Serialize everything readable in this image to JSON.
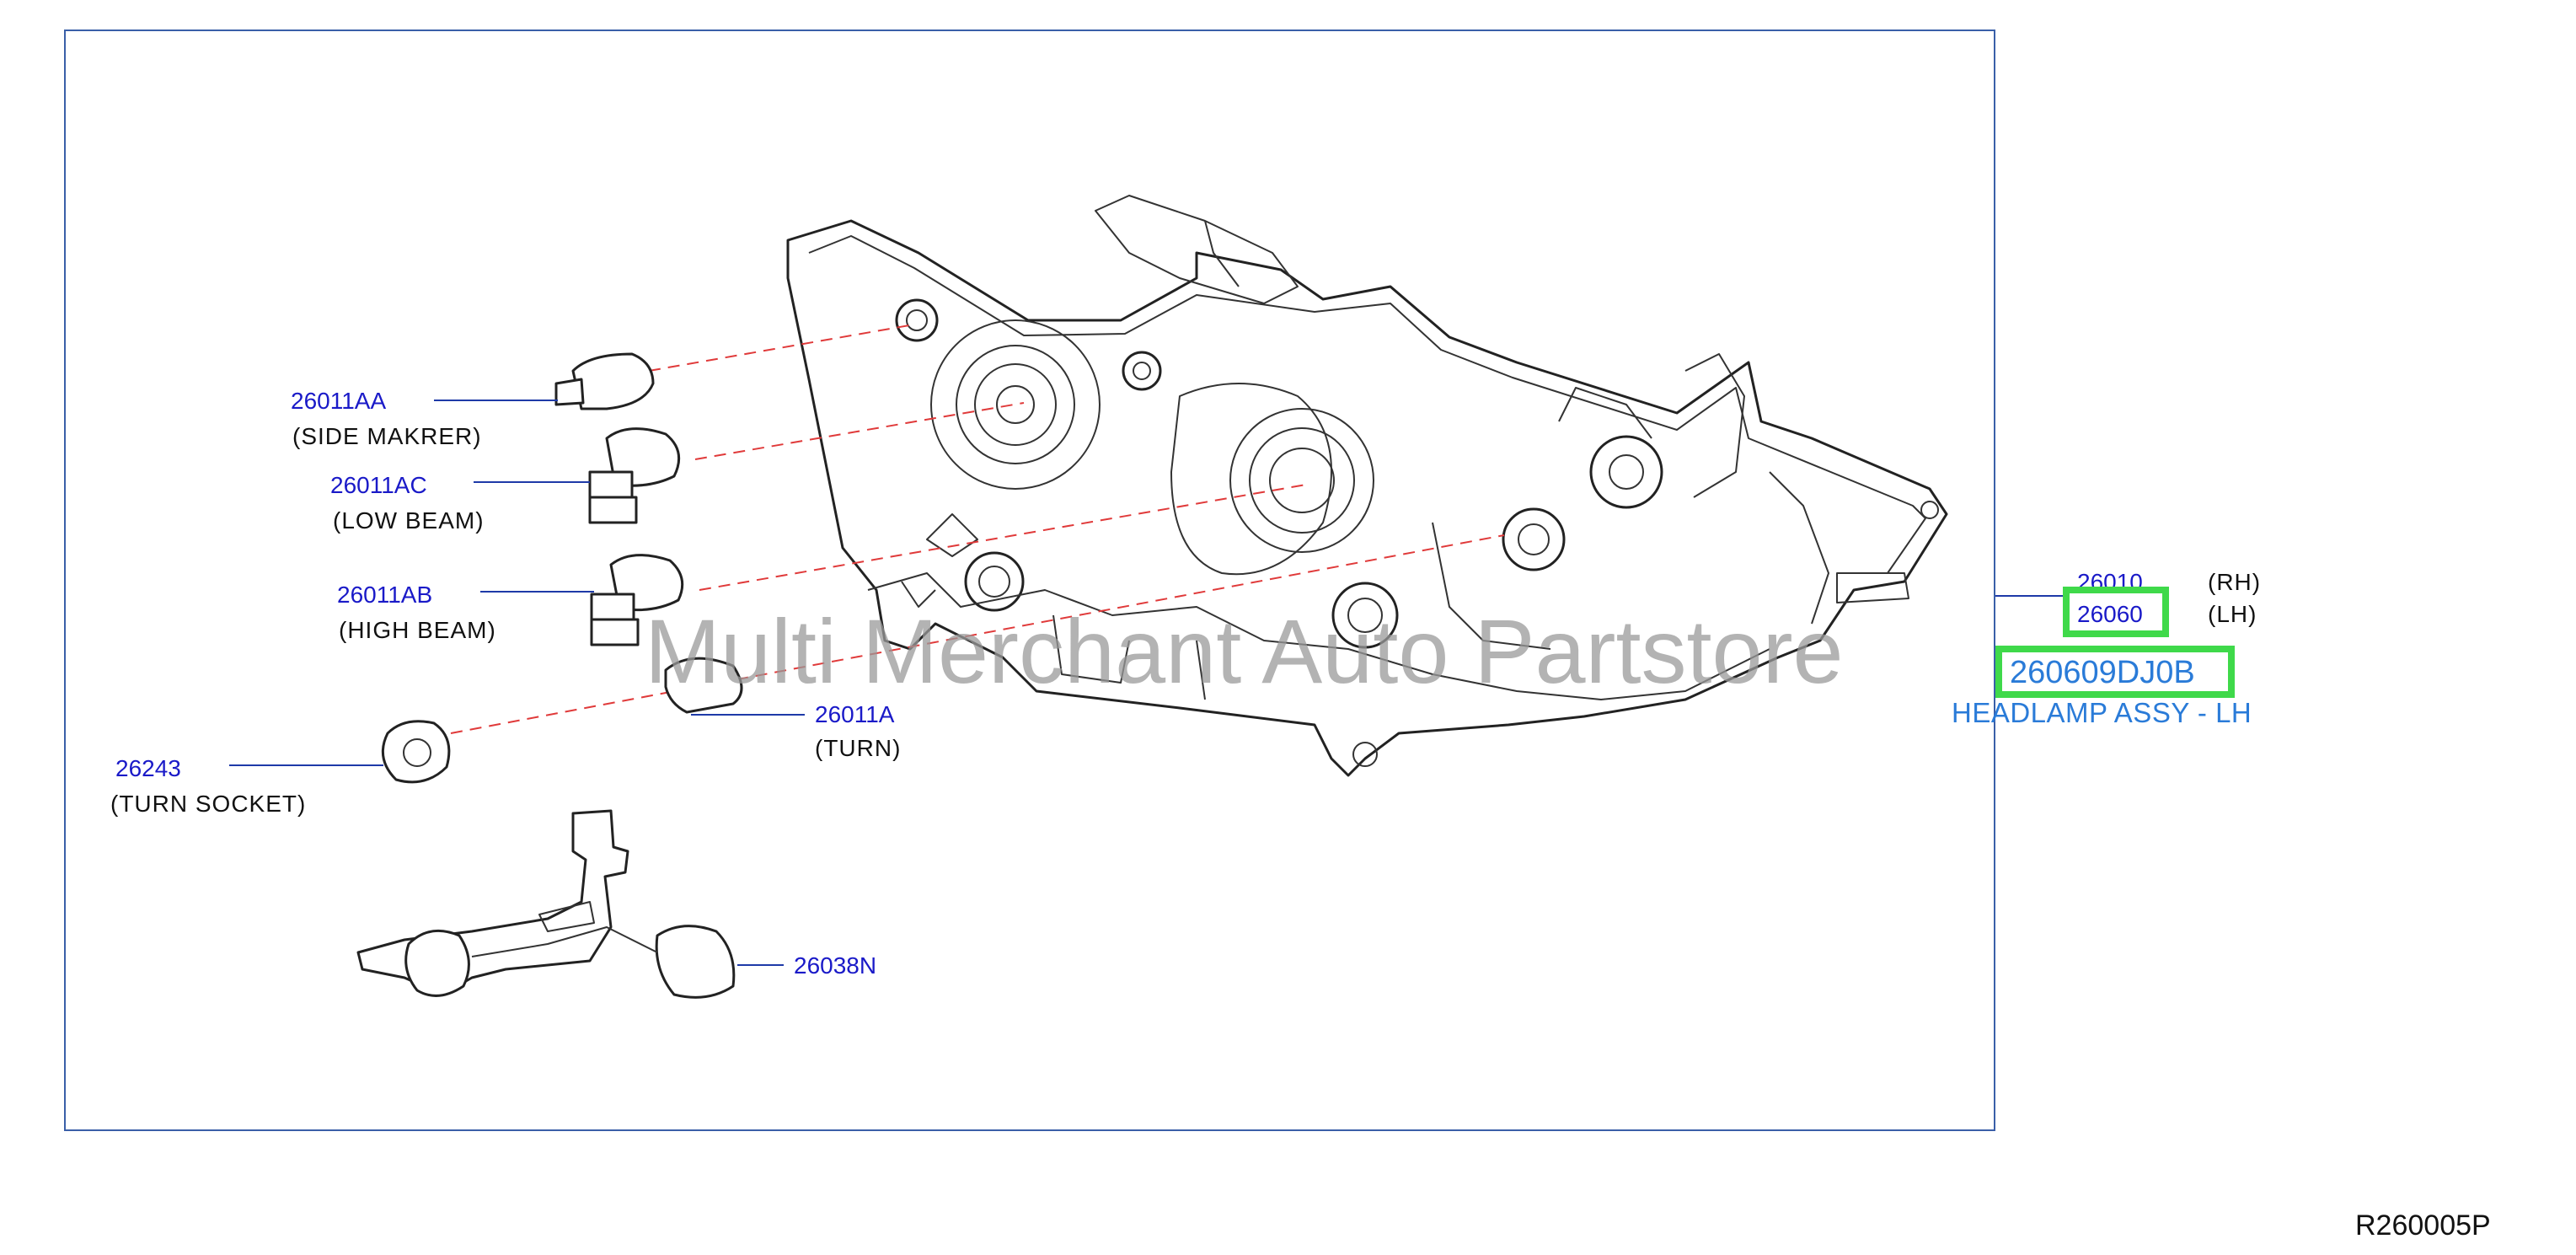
{
  "diagram": {
    "frame_color": "#3a5fa8",
    "code_color": "#1a1ac8",
    "highlight_color": "#3fd94a",
    "assembly_text_color": "#2a7bd8",
    "watermark": "Multi Merchant Auto Partstore",
    "diagram_ref": "R260005P",
    "callouts": {
      "side_marker": {
        "code": "26011AA",
        "desc": "(SIDE   MAKRER)"
      },
      "low_beam": {
        "code": "26011AC",
        "desc": "(LOW   BEAM)"
      },
      "high_beam": {
        "code": "26011AB",
        "desc": "(HIGH   BEAM)"
      },
      "turn_bulb": {
        "code": "26011A",
        "desc": "(TURN)"
      },
      "turn_socket": {
        "code": "26243",
        "desc": "(TURN   SOCKET)"
      },
      "harness": {
        "code": "26038N"
      }
    },
    "assembly": {
      "rh_code": "26010",
      "rh_label": "(RH)",
      "lh_code": "26060",
      "lh_label": "(LH)",
      "part_number": "260609DJ0B",
      "name": "HEADLAMP ASSY - LH"
    }
  }
}
